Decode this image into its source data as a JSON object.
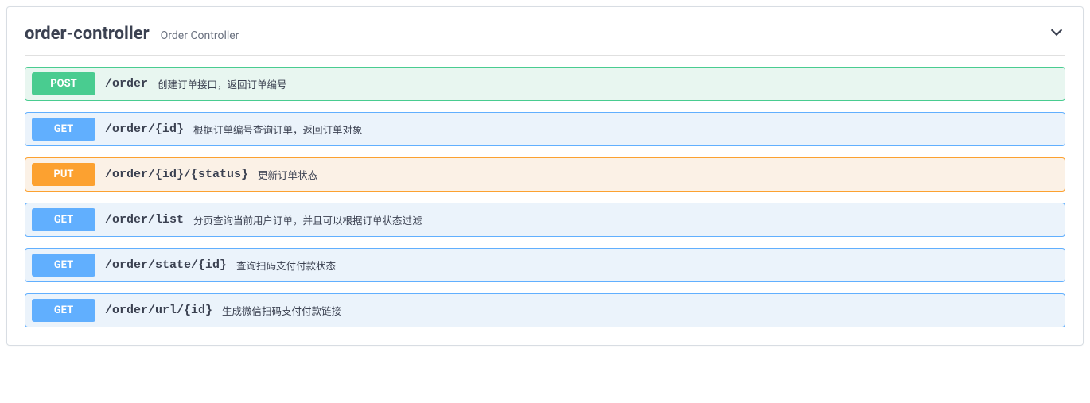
{
  "controller": {
    "name": "order-controller",
    "description": "Order Controller"
  },
  "operations": [
    {
      "method": "POST",
      "methodClass": "post",
      "path": "/order",
      "summary": "创建订单接口，返回订单编号"
    },
    {
      "method": "GET",
      "methodClass": "get",
      "path": "/order/{id}",
      "summary": "根据订单编号查询订单，返回订单对象"
    },
    {
      "method": "PUT",
      "methodClass": "put",
      "path": "/order/{id}/{status}",
      "summary": "更新订单状态"
    },
    {
      "method": "GET",
      "methodClass": "get",
      "path": "/order/list",
      "summary": "分页查询当前用户订单，并且可以根据订单状态过滤"
    },
    {
      "method": "GET",
      "methodClass": "get",
      "path": "/order/state/{id}",
      "summary": "查询扫码支付付款状态"
    },
    {
      "method": "GET",
      "methodClass": "get",
      "path": "/order/url/{id}",
      "summary": "生成微信扫码支付付款链接"
    }
  ]
}
